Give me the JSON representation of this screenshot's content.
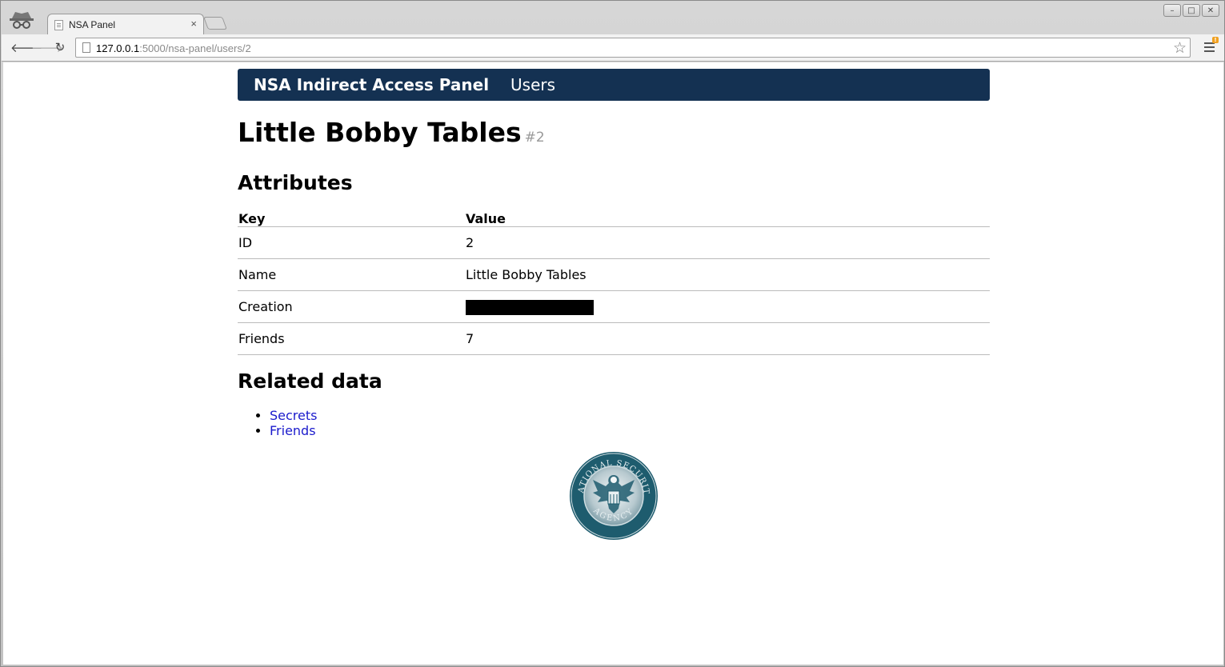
{
  "browser": {
    "tab_title": "NSA Panel",
    "tab_close": "×",
    "url_host": "127.0.0.1",
    "url_rest": ":5000/nsa-panel/users/2",
    "window_controls": [
      "–",
      "□",
      "✕"
    ],
    "menu_badge": "!"
  },
  "navbar": {
    "brand": "NSA Indirect Access Panel",
    "users_link": "Users",
    "background_color": "#143152"
  },
  "user": {
    "name": "Little Bobby Tables",
    "id_label": "#2"
  },
  "attributes": {
    "heading": "Attributes",
    "columns": {
      "key": "Key",
      "value": "Value"
    },
    "rows": [
      {
        "key": "ID",
        "value": "2"
      },
      {
        "key": "Name",
        "value": "Little Bobby Tables"
      },
      {
        "key": "Creation",
        "value": ""
      },
      {
        "key": "Friends",
        "value": "7"
      }
    ]
  },
  "related": {
    "heading": "Related data",
    "links": [
      "Secrets",
      "Friends"
    ],
    "link_color": "#1a1acc"
  },
  "seal": {
    "top_text": "NATIONAL SECURITY",
    "bottom_text": "AGENCY",
    "color": "#1e5c6e"
  }
}
